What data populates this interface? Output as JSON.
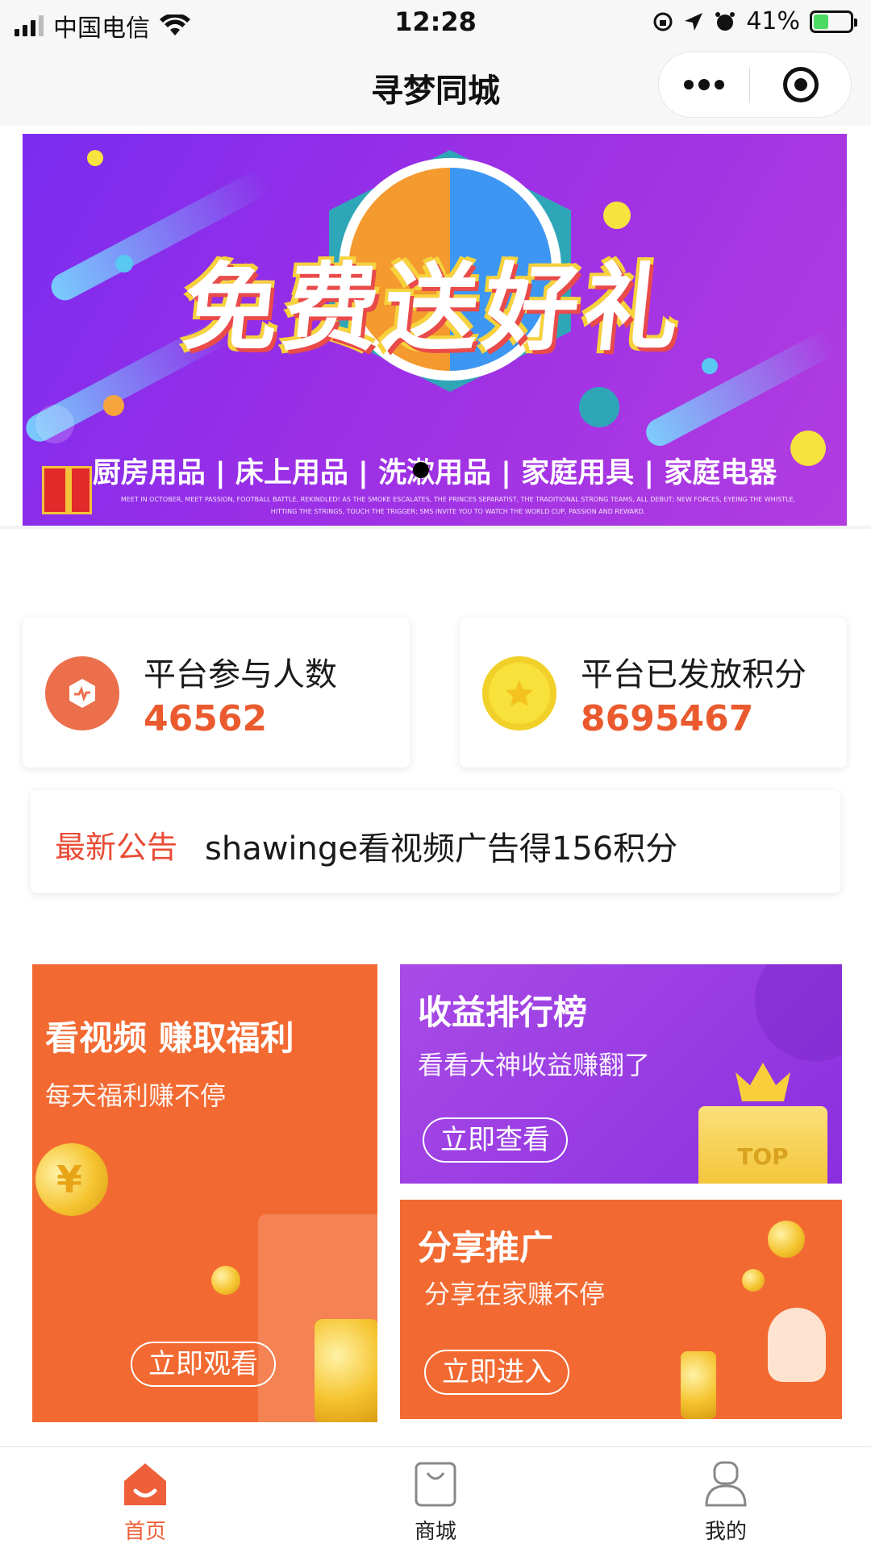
{
  "status_bar": {
    "carrier": "中国电信",
    "time": "12:28",
    "battery_percent": "41%",
    "battery_level": 0.41
  },
  "nav": {
    "title": "寻梦同城"
  },
  "banner": {
    "headline": "免费送好礼",
    "categories": "厨房用品 | 床上用品 | 洗漱用品 | 家庭用具 | 家庭电器",
    "fine_print": "MEET IN OCTOBER, MEET PASSION, FOOTBALL BATTLE, REKINDLED! AS THE SMOKE ESCALATES, THE PRINCES SEPARATIST, THE TRADITIONAL STRONG TEAMS, ALL DEBUT; NEW FORCES, EYEING THE WHISTLE, HITTING THE STRINGS, TOUCH THE TRIGGER; SMS INVITE YOU TO WATCH THE WORLD CUP, PASSION AND REWARD."
  },
  "stats": {
    "participants": {
      "label": "平台参与人数",
      "value": "46562"
    },
    "points": {
      "label": "平台已发放积分",
      "value": "8695467"
    }
  },
  "notice": {
    "tag": "最新公告",
    "text": "shawinge看视频广告得156积分"
  },
  "features": {
    "video": {
      "title": "看视频 赚取福利",
      "subtitle": "每天福利赚不停",
      "button": "立即观看"
    },
    "ranking": {
      "title": "收益排行榜",
      "subtitle": "看看大神收益赚翻了",
      "button": "立即查看",
      "badge": "TOP"
    },
    "share": {
      "title": "分享推广",
      "subtitle": "分享在家赚不停",
      "button": "立即进入"
    }
  },
  "tabbar": {
    "home": "首页",
    "mall": "商城",
    "mine": "我的"
  },
  "colors": {
    "accent": "#ea5a2e",
    "notice_tag": "#e94b35",
    "video_card": "#f26a32",
    "ranking_card": "#a03ce8",
    "share_card": "#f26a32"
  }
}
